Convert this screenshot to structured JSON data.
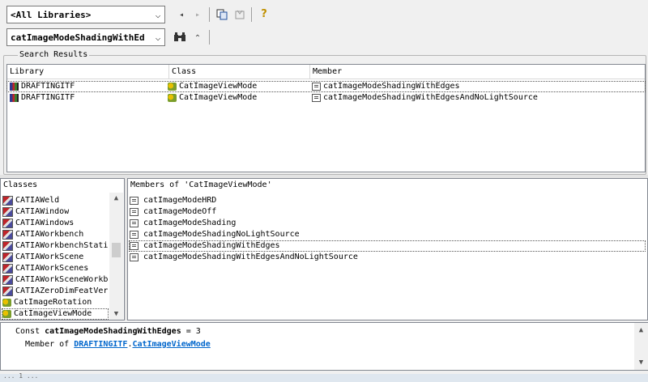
{
  "toolbar": {
    "library_combo": "<All Libraries>",
    "search_combo": "catImageModeShadingWithEd"
  },
  "search_results": {
    "title": "Search Results",
    "columns": [
      "Library",
      "Class",
      "Member"
    ],
    "rows": [
      {
        "library": "DRAFTINGITF",
        "class": "CatImageViewMode",
        "member": "catImageModeShadingWithEdges"
      },
      {
        "library": "DRAFTINGITF",
        "class": "CatImageViewMode",
        "member": "catImageModeShadingWithEdgesAndNoLightSource"
      }
    ]
  },
  "classes": {
    "title": "Classes",
    "items": [
      "CATIAWeld",
      "CATIAWindow",
      "CATIAWindows",
      "CATIAWorkbench",
      "CATIAWorkbenchStati",
      "CATIAWorkScene",
      "CATIAWorkScenes",
      "CATIAWorkSceneWorkb",
      "CATIAZeroDimFeatVer",
      "CatImageRotation",
      "CatImageViewMode"
    ]
  },
  "members": {
    "title": "Members of 'CatImageViewMode'",
    "items": [
      "catImageModeHRD",
      "catImageModeOff",
      "catImageModeShading",
      "catImageModeShadingNoLightSource",
      "catImageModeShadingWithEdges",
      "catImageModeShadingWithEdgesAndNoLightSource"
    ]
  },
  "detail": {
    "prefix": "Const",
    "name": "catImageModeShadingWithEdges",
    "value": "= 3",
    "member_of_label": "Member of",
    "library_link": "DRAFTINGITF",
    "class_link": "CatImageViewMode"
  },
  "status": {
    "text": "... 1 ..."
  }
}
